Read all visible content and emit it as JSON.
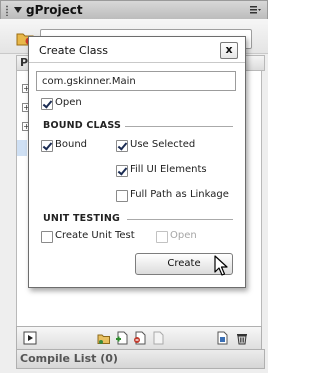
{
  "panel": {
    "title": "gProject",
    "project_name": "",
    "tree_header": "P",
    "compile_list_label": "Compile List (0)"
  },
  "dialog": {
    "title": "Create Class",
    "close_label": "x",
    "class_name_value": "com.gskinner.Main",
    "open_label": "Open",
    "bound_class": {
      "heading": "BOUND CLASS",
      "bound_label": "Bound",
      "use_selected_label": "Use Selected",
      "fill_ui_label": "Fill UI Elements",
      "full_path_label": "Full Path as Linkage"
    },
    "unit_testing": {
      "heading": "UNIT TESTING",
      "create_unit_test_label": "Create Unit Test",
      "open_label": "Open"
    },
    "create_label": "Create"
  },
  "checkbox_states": {
    "open": true,
    "bound": true,
    "use_selected": true,
    "fill_ui": true,
    "full_path": false,
    "create_unit_test": false,
    "unit_open": false
  },
  "icons": {
    "panel_menu": "list-menu-icon",
    "project": "project-folder-icon",
    "collapse": "triangle-down-icon",
    "bottom_left": "play-box-icon",
    "bottom_group": [
      "add-folder-icon",
      "add-file-icon",
      "remove-file-icon",
      "blank-file-icon"
    ],
    "bottom_right": [
      "settings-doc-icon",
      "trash-icon"
    ],
    "cursor": "mouse-pointer-icon"
  }
}
